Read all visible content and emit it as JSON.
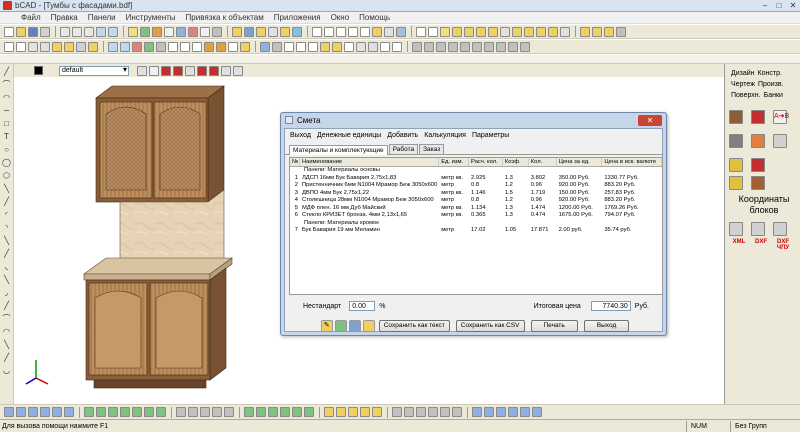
{
  "window": {
    "title": "bCAD - [Тумбы с фасадами.bdf]"
  },
  "menu": [
    "Файл",
    "Правка",
    "Панели",
    "Инструменты",
    "Привязка к объектам",
    "Приложения",
    "Окно",
    "Помощь"
  ],
  "properties": {
    "layer": "default",
    "color": "#000000"
  },
  "right_panel": {
    "tabs": [
      "Дизайн",
      "Констр.",
      "Чертеж",
      "Произв.",
      "Поверхн.",
      "Банки"
    ],
    "coords_label": "Координаты блоков",
    "export": [
      "XML",
      "DXF",
      "DXF ЧПУ"
    ]
  },
  "status": {
    "message": "Для вызова помощи нажмите F1",
    "num": "NUM",
    "group": "Без Групп"
  },
  "dialog": {
    "title": "Смета",
    "menu": [
      "Выход",
      "Денежные единицы",
      "Добавить",
      "Калькуляция",
      "Параметры"
    ],
    "tabs": [
      "Материалы и комплектующие",
      "Работа",
      "Заказ"
    ],
    "columns": [
      "№",
      "Наименование",
      "Ед. изм.",
      "Расч. кол.",
      "Коэф.",
      "Кол.",
      "Цена за ед.",
      "Цена в иск. валюте"
    ],
    "rows": [
      {
        "n": "",
        "name": "Панели: Материалы основы",
        "unit": "",
        "calc": "",
        "coef": "",
        "qty": "",
        "price": "",
        "total": ""
      },
      {
        "n": "1",
        "name": "ЛДСП 16мм Бук Бавария 2,75x1,83",
        "unit": "метр кв.",
        "calc": "2.925",
        "coef": "1.3",
        "qty": "3.802",
        "price": "350.00 Руб.",
        "total": "1330.77 Руб."
      },
      {
        "n": "2",
        "name": "Пристенничник 6мм N1004 Мрамор Беж 3050x600",
        "unit": "метр",
        "calc": "0.8",
        "coef": "1.2",
        "qty": "0.96",
        "price": "920.00 Руб.",
        "total": "883.20 Руб."
      },
      {
        "n": "3",
        "name": "ДВПО 4мм Бук 2,75x1,22",
        "unit": "метр кв.",
        "calc": "1.146",
        "coef": "1.5",
        "qty": "1.719",
        "price": "150.00 Руб.",
        "total": "257.83 Руб."
      },
      {
        "n": "4",
        "name": "Столешница 28мм N1004 Мрамор Беж 3050x600",
        "unit": "метр",
        "calc": "0.8",
        "coef": "1.2",
        "qty": "0.96",
        "price": "920.00 Руб.",
        "total": "883.20 Руб."
      },
      {
        "n": "5",
        "name": "МДФ плен. 16 мм Дуб Майский",
        "unit": "метр кв.",
        "calc": "1.134",
        "coef": "1.3",
        "qty": "1.474",
        "price": "1200.00 Руб.",
        "total": "1769.26 Руб."
      },
      {
        "n": "6",
        "name": "Стекло КРИЗЕТ бронза. 4мм 2,13x1,65",
        "unit": "метр кв.",
        "calc": "0.365",
        "coef": "1.3",
        "qty": "0.474",
        "price": "1675.00 Руб.",
        "total": "794.07 Руб."
      },
      {
        "n": "",
        "name": "Панели: Материалы кромок",
        "unit": "",
        "calc": "",
        "coef": "",
        "qty": "",
        "price": "",
        "total": ""
      },
      {
        "n": "7",
        "name": "Бук Бавария 19 мм Меламин",
        "unit": "метр",
        "calc": "17.02",
        "coef": "1.05",
        "qty": "17.871",
        "price": "2.00 руб.",
        "total": "35.74 руб."
      }
    ],
    "nonstandard_label": "Нестандарт",
    "nonstandard_value": "0.00",
    "nonstandard_unit": "%",
    "total_label": "Итоговая цена",
    "total_value": "7740.30",
    "total_currency": "Руб.",
    "buttons": {
      "save_text": "Сохранить как текст",
      "save_csv": "Сохранить как CSV",
      "print": "Печать",
      "exit": "Выход"
    }
  }
}
